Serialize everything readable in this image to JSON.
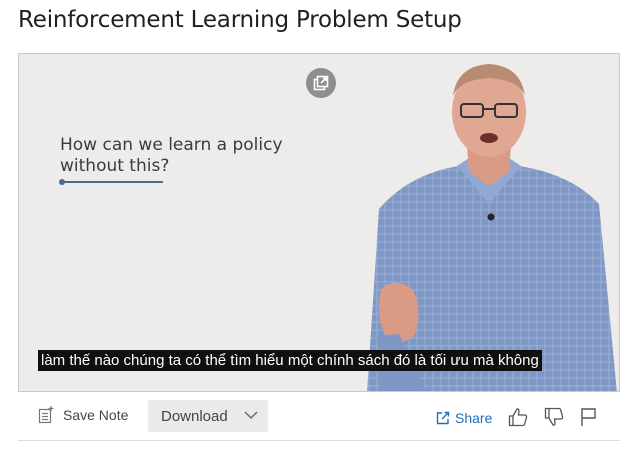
{
  "page": {
    "title": "Reinforcement Learning Problem Setup"
  },
  "video": {
    "slide_text": "How can we learn a policy\nwithout this?",
    "caption": "làm thế nào chúng ta có thể tìm hiểu một chính sách đó là tối ưu mà không"
  },
  "toolbar": {
    "save_note_label": "Save Note",
    "download_label": "Download",
    "share_label": "Share"
  },
  "icons": {
    "popout": "popout-icon",
    "note": "note-icon",
    "chevron": "chevron-down-icon",
    "share": "share-icon",
    "like": "thumbs-up-icon",
    "dislike": "thumbs-down-icon",
    "flag": "flag-icon"
  },
  "colors": {
    "link": "#1f6fb8",
    "slide_bg": "#eeeceb",
    "caption_bg": "#101010"
  }
}
